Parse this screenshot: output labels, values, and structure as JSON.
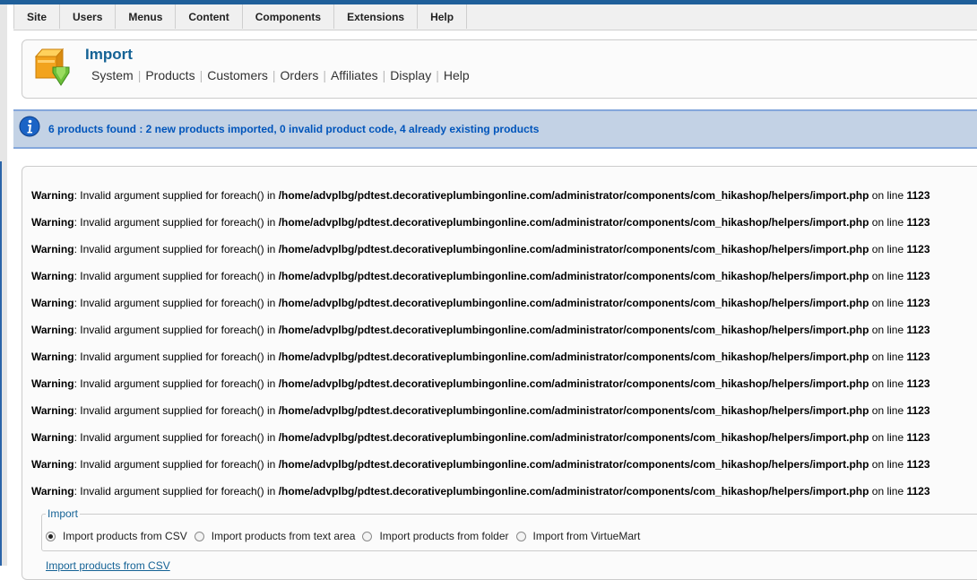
{
  "menubar": {
    "items": [
      "Site",
      "Users",
      "Menus",
      "Content",
      "Components",
      "Extensions",
      "Help"
    ]
  },
  "header": {
    "title": "Import",
    "subnav": [
      "System",
      "Products",
      "Customers",
      "Orders",
      "Affiliates",
      "Display",
      "Help"
    ]
  },
  "message": {
    "text": "6 products found : 2 new products imported, 0 invalid product code, 4 already existing products"
  },
  "warnings": {
    "label": "Warning",
    "text": ": Invalid argument supplied for foreach() in ",
    "path": "/home/advplbg/pdtest.decorativeplumbingonline.com/administrator/components/com_hikashop/helpers/import.php",
    "online": " on line ",
    "line": "1123",
    "count": 12
  },
  "import_section": {
    "legend": "Import",
    "options": [
      {
        "label": "Import products from CSV",
        "selected": true
      },
      {
        "label": "Import products from text area",
        "selected": false
      },
      {
        "label": "Import products from folder",
        "selected": false
      },
      {
        "label": "Import from VirtueMart",
        "selected": false
      }
    ],
    "next_label": "Import products from CSV"
  }
}
